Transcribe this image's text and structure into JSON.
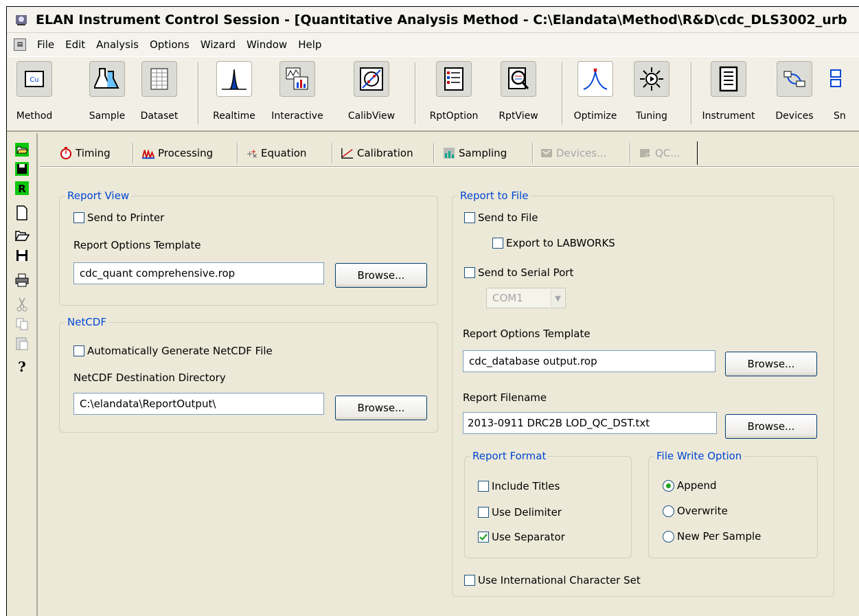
{
  "window": {
    "title": "ELAN Instrument Control Session - [Quantitative Analysis Method - C:\\Elandata\\Method\\R&D\\cdc_DLS3002_urb"
  },
  "menu": [
    "File",
    "Edit",
    "Analysis",
    "Options",
    "Wizard",
    "Window",
    "Help"
  ],
  "toolbar": {
    "buttons": [
      {
        "label": "Method",
        "icon": "method-icon"
      },
      {
        "label": "Sample",
        "icon": "flask-icon"
      },
      {
        "label": "Dataset",
        "icon": "dataset-icon"
      },
      {
        "label": "Realtime",
        "icon": "peak-icon"
      },
      {
        "label": "Interactive",
        "icon": "interactive-icon"
      },
      {
        "label": "CalibView",
        "icon": "calibview-icon"
      },
      {
        "label": "RptOption",
        "icon": "rptoption-icon"
      },
      {
        "label": "RptView",
        "icon": "rptview-icon"
      },
      {
        "label": "Optimize",
        "icon": "optimize-icon"
      },
      {
        "label": "Tuning",
        "icon": "tuning-icon"
      },
      {
        "label": "Instrument",
        "icon": "instrument-icon"
      },
      {
        "label": "Devices",
        "icon": "devices-icon"
      },
      {
        "label": "Sn",
        "icon": "smartsampler-icon"
      }
    ]
  },
  "left_toolbar": [
    "open-method-icon",
    "save-method-icon",
    "r-icon",
    "new-icon",
    "open-icon",
    "save-icon",
    "print-icon",
    "cut-icon",
    "copy-icon",
    "paste-icon",
    "help-icon"
  ],
  "tabs": [
    {
      "label": "Timing",
      "icon": "stopwatch-icon",
      "enabled": true
    },
    {
      "label": "Processing",
      "icon": "processing-icon",
      "enabled": true
    },
    {
      "label": "Equation",
      "icon": "equation-icon",
      "enabled": true
    },
    {
      "label": "Calibration",
      "icon": "calibration-icon",
      "enabled": true
    },
    {
      "label": "Sampling",
      "icon": "sampling-icon",
      "enabled": true
    },
    {
      "label": "Devices...",
      "icon": "devices-tab-icon",
      "enabled": false
    },
    {
      "label": "QC...",
      "icon": "qc-icon",
      "enabled": false
    }
  ],
  "report_view": {
    "legend": "Report View",
    "send_to_printer": {
      "label": "Send to Printer",
      "checked": false
    },
    "template_label": "Report Options Template",
    "template_value": "cdc_quant comprehensive.rop",
    "browse": "Browse..."
  },
  "netcdf": {
    "legend": "NetCDF",
    "auto_generate": {
      "label": "Automatically Generate NetCDF File",
      "checked": false
    },
    "dest_label": "NetCDF Destination Directory",
    "dest_value": "C:\\elandata\\ReportOutput\\",
    "browse": "Browse..."
  },
  "report_to_file": {
    "legend": "Report to File",
    "send_to_file": {
      "label": "Send to File",
      "checked": false
    },
    "export_labworks": {
      "label": "Export to LABWORKS",
      "checked": false
    },
    "send_serial": {
      "label": "Send to Serial Port",
      "checked": false
    },
    "serial_port": "COM1",
    "template_label": "Report Options Template",
    "template_value": "cdc_database output.rop",
    "template_browse": "Browse...",
    "filename_label": "Report Filename",
    "filename_value": "2013-0911 DRC2B LOD_QC_DST.txt",
    "filename_browse": "Browse...",
    "format": {
      "legend": "Report Format",
      "include_titles": {
        "label": "Include Titles",
        "checked": false
      },
      "use_delimiter": {
        "label": "Use Delimiter",
        "checked": false
      },
      "use_separator": {
        "label": "Use Separator",
        "checked": true
      }
    },
    "write_option": {
      "legend": "File Write Option",
      "append": {
        "label": "Append",
        "selected": true
      },
      "overwrite": {
        "label": "Overwrite",
        "selected": false
      },
      "new_per_sample": {
        "label": "New Per Sample",
        "selected": false
      }
    },
    "intl_charset": {
      "label": "Use International Character Set",
      "checked": false
    }
  }
}
